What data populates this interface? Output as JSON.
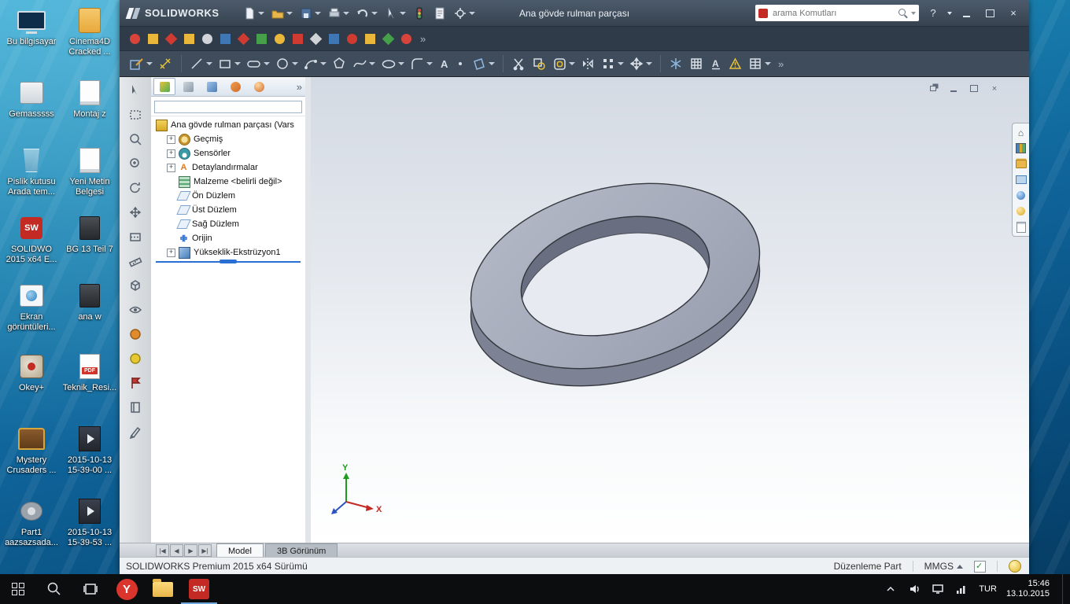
{
  "window": {
    "brand": "SOLIDWORKS",
    "title": "Ana gövde rulman parçası",
    "search_placeholder": "arama Komutları"
  },
  "desktop": {
    "icons": [
      {
        "label": "Bu bilgisayar"
      },
      {
        "label": "Cinema4D Cracked ..."
      },
      {
        "label": "Gemasssss"
      },
      {
        "label": "Montaj z"
      },
      {
        "label": "Pislik kutusu Arada tem..."
      },
      {
        "label": "Yeni Metin Belgesi"
      },
      {
        "label": "SOLIDWO 2015 x64 E..."
      },
      {
        "label": "BG 13 Teil 7"
      },
      {
        "label": "Ekran görüntüleri..."
      },
      {
        "label": "ana w"
      },
      {
        "label": "Okey+"
      },
      {
        "label": "Teknik_Resi..."
      },
      {
        "label": "Mystery Crusaders ..."
      },
      {
        "label": "2015-10-13 15-39-00 ..."
      },
      {
        "label": "Part1 aazsazsada..."
      },
      {
        "label": "2015-10-13 15-39-53 ..."
      }
    ]
  },
  "feature_tree": {
    "root_label": "Ana gövde rulman parçası  (Vars",
    "items": [
      {
        "label": "Geçmiş"
      },
      {
        "label": "Sensörler"
      },
      {
        "label": "Detaylandırmalar"
      },
      {
        "label": "Malzeme <belirli değil>"
      },
      {
        "label": "Ön Düzlem"
      },
      {
        "label": "Üst Düzlem"
      },
      {
        "label": "Sağ Düzlem"
      },
      {
        "label": "Orijin"
      },
      {
        "label": "Yükseklik-Ekstrüzyon1"
      }
    ]
  },
  "viewport": {
    "triad": {
      "x": "X",
      "y": "Y"
    },
    "tabs": [
      {
        "label": "Model"
      },
      {
        "label": "3B Görünüm"
      }
    ]
  },
  "statusbar": {
    "left": "SOLIDWORKS Premium 2015 x64 Sürümü",
    "mode": "Düzenleme Part",
    "units": "MMGS"
  },
  "taskbar": {
    "language": "TUR",
    "time": "15:46",
    "date": "13.10.2015"
  },
  "colors": {
    "accent": "#2a6fd4",
    "part_top": "#a8adbd",
    "part_side": "#7d8294",
    "taskbar": "#0c0d0f"
  }
}
